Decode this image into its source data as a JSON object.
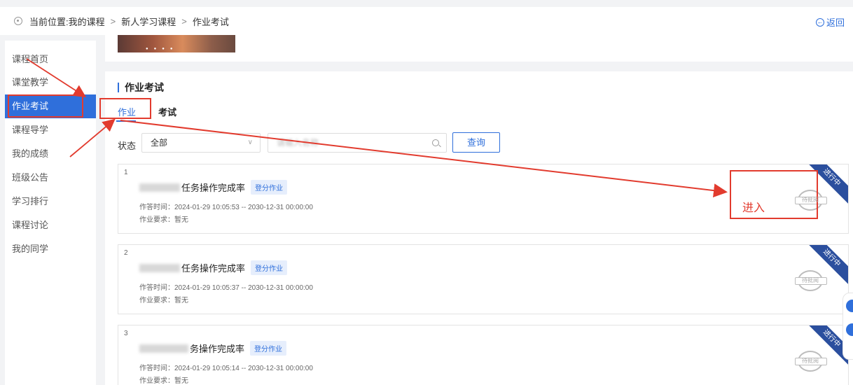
{
  "breadcrumb": {
    "location": "当前位置:我的课程",
    "sep1": ">",
    "course": "新人学习课程",
    "sep2": ">",
    "page": "作业考试",
    "back": "返回"
  },
  "sidebar": {
    "items": [
      {
        "label": "课程首页"
      },
      {
        "label": "课堂教学"
      },
      {
        "label": "作业考试"
      },
      {
        "label": "课程导学"
      },
      {
        "label": "我的成绩"
      },
      {
        "label": "班级公告"
      },
      {
        "label": "学习排行"
      },
      {
        "label": "课程讨论"
      },
      {
        "label": "我的同学"
      }
    ],
    "active_index": 2
  },
  "section": {
    "title": "作业考试",
    "tabs": [
      {
        "label": "作业"
      },
      {
        "label": "考试"
      }
    ]
  },
  "filter": {
    "status_label": "状态",
    "status_value": "全部",
    "search_placeholder": "请输入名称",
    "query_label": "查询"
  },
  "assignments": [
    {
      "num": "1",
      "title": "任务操作完成率",
      "badge": "登分作业",
      "time": "作答时间：2024-01-29 10:05:53 -- 2030-12-31 00:00:00",
      "requirement": "作业要求：暂无",
      "status": "进行中",
      "action": "待批阅"
    },
    {
      "num": "2",
      "title": "任务操作完成率",
      "badge": "登分作业",
      "time": "作答时间：2024-01-29 10:05:37 -- 2030-12-31 00:00:00",
      "requirement": "作业要求：暂无",
      "status": "进行中",
      "action": "待批阅"
    },
    {
      "num": "3",
      "title": "务操作完成率",
      "badge": "登分作业",
      "time": "作答时间：2024-01-29 10:05:14 -- 2030-12-31 00:00:00",
      "requirement": "作业要求：暂无",
      "status": "进行中",
      "action": "待批阅"
    }
  ],
  "annotation": {
    "enter_label": "进入"
  },
  "colors": {
    "accent": "#2f6fdb",
    "annotation_red": "#e23b2e",
    "ribbon": "#2b4f9e"
  }
}
